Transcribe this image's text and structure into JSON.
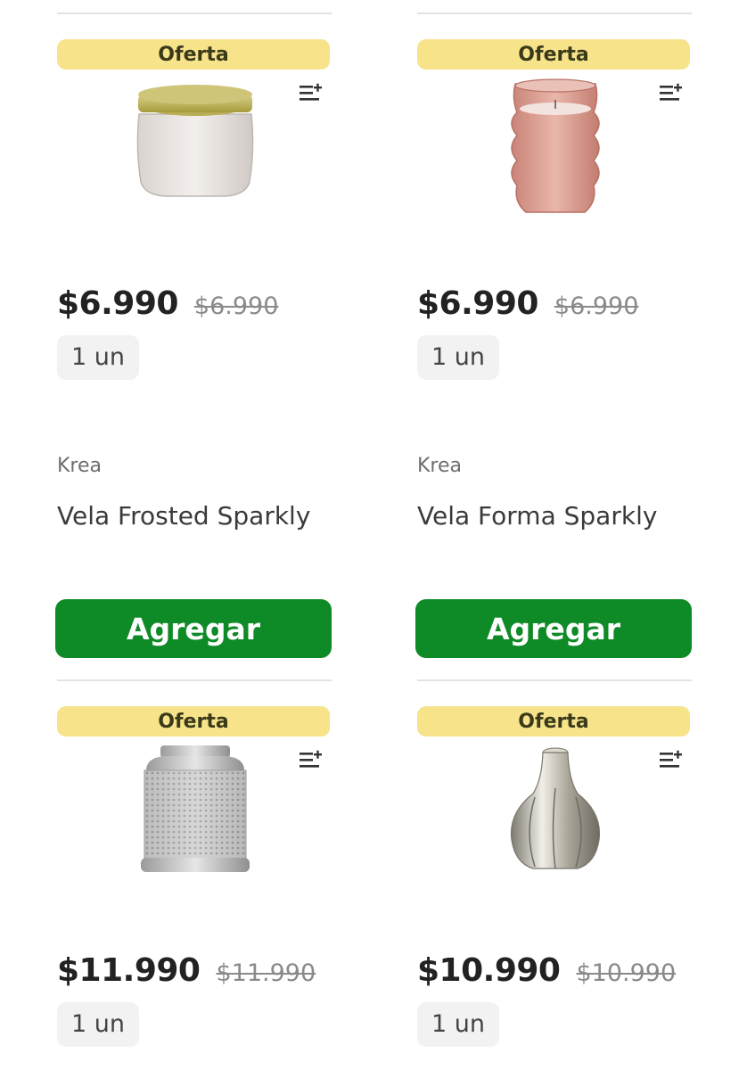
{
  "products": [
    {
      "badge": "Oferta",
      "price": "$6.990",
      "old_price": "$6.990",
      "unit": "1 un",
      "brand": "Krea",
      "name": "Vela Frosted Sparkly",
      "button": "Agregar",
      "image_icon": "frosted-candle-jar"
    },
    {
      "badge": "Oferta",
      "price": "$6.990",
      "old_price": "$6.990",
      "unit": "1 un",
      "brand": "Krea",
      "name": "Vela Forma Sparkly",
      "button": "Agregar",
      "image_icon": "pink-wavy-candle"
    },
    {
      "badge": "Oferta",
      "price": "$11.990",
      "old_price": "$11.990",
      "unit": "1 un",
      "image_icon": "silver-lantern"
    },
    {
      "badge": "Oferta",
      "price": "$10.990",
      "old_price": "$10.990",
      "unit": "1 un",
      "image_icon": "silver-bulb-vase"
    }
  ],
  "colors": {
    "badge_bg": "#f7e38a",
    "button_bg": "#0e8a27",
    "chip_bg": "#f2f2f2"
  },
  "icons": {
    "list_add": "playlist-add-icon"
  }
}
